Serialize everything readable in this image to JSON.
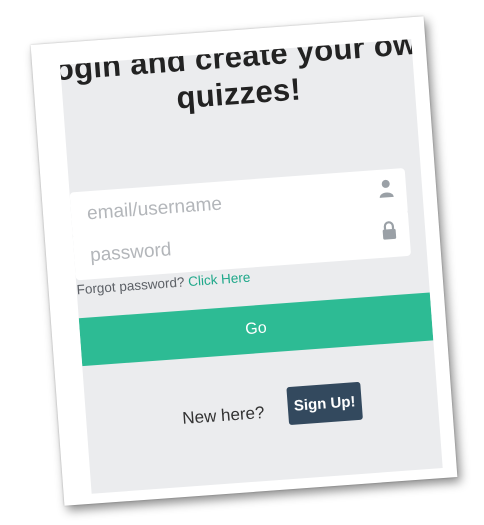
{
  "heading": "Login and create your own\nquizzes!",
  "login_form": {
    "email_placeholder": "email/username",
    "email_icon": "user-icon",
    "password_placeholder": "password",
    "password_icon": "lock-icon",
    "forgot_text": "Forgot password?",
    "forgot_link": "Click Here",
    "go_label": "Go"
  },
  "signup": {
    "prompt": "New here?",
    "button_label": "Sign Up!"
  },
  "colors": {
    "panel_background": "#ebecee",
    "accent_green": "#2dbb94",
    "link_green": "#1fa88a",
    "signup_navy": "#33495e",
    "icon_grey": "#9aa0a6"
  }
}
